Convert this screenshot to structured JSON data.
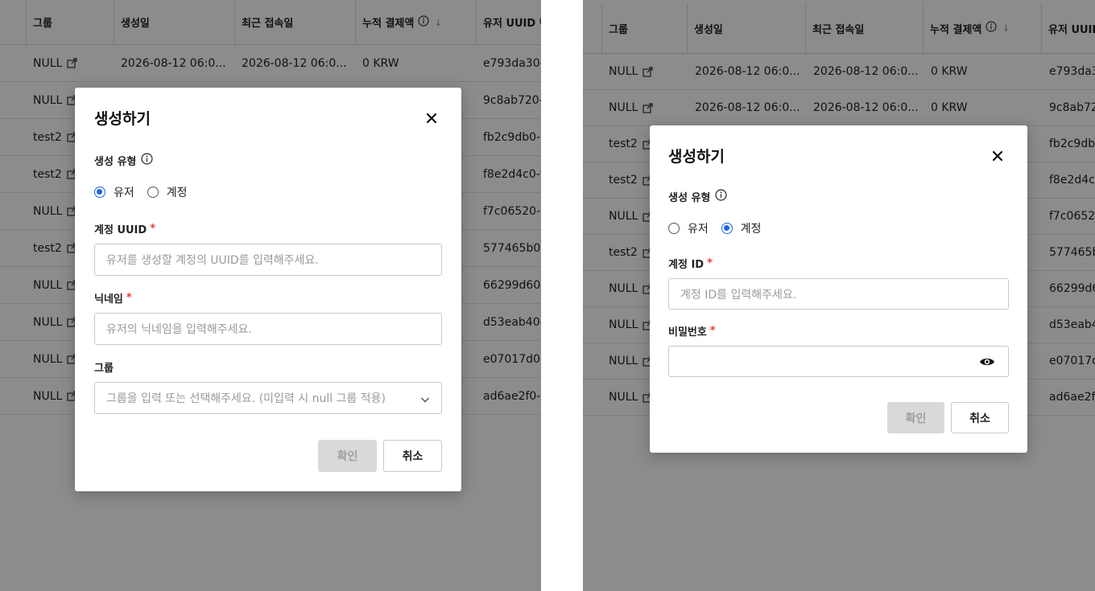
{
  "table": {
    "columns": {
      "group": "그룹",
      "created": "생성일",
      "last_access": "최근 접속일",
      "payment": "누적 결제액",
      "uuid": "유저 UUID"
    },
    "rows": [
      {
        "group": "NULL",
        "created": "2026-08-12 06:0...",
        "last_access": "2026-08-12 06:0...",
        "payment": "0 KRW",
        "uuid": "e793da30-"
      },
      {
        "group": "NULL",
        "created": "2026-08-12 06:0...",
        "last_access": "2026-08-12 06:0...",
        "payment": "0 KRW",
        "uuid": "9c8ab720-"
      },
      {
        "group": "test2",
        "created": "",
        "last_access": "",
        "payment": "",
        "uuid": "fb2c9db0-9"
      },
      {
        "group": "test2",
        "created": "",
        "last_access": "",
        "payment": "",
        "uuid": "f8e2d4c0-9"
      },
      {
        "group": "NULL",
        "created": "",
        "last_access": "",
        "payment": "",
        "uuid": "f7c06520-9"
      },
      {
        "group": "test2",
        "created": "",
        "last_access": "",
        "payment": "",
        "uuid": "577465b0-"
      },
      {
        "group": "NULL",
        "created": "",
        "last_access": "",
        "payment": "",
        "uuid": "66299d60-"
      },
      {
        "group": "NULL",
        "created": "",
        "last_access": "",
        "payment": "",
        "uuid": "d53eab40-"
      },
      {
        "group": "NULL",
        "created": "",
        "last_access": "",
        "payment": "",
        "uuid": "e07017d0-9"
      },
      {
        "group": "NULL",
        "created": "",
        "last_access": "",
        "payment": "",
        "uuid": "ad6ae2f0-9"
      }
    ]
  },
  "modal_user": {
    "title": "생성하기",
    "type_label": "생성 유형",
    "options": [
      "유저",
      "계정"
    ],
    "selected": 0,
    "uuid_label": "계정 UUID",
    "uuid_placeholder": "유저를 생성할 계정의 UUID를 입력해주세요.",
    "nickname_label": "닉네임",
    "nickname_placeholder": "유저의 닉네임을 입력해주세요.",
    "group_label": "그룹",
    "group_placeholder": "그룹을 입력 또는 선택해주세요. (미입력 시 null 그룹 적용)",
    "confirm": "확인",
    "cancel": "취소"
  },
  "modal_account": {
    "title": "생성하기",
    "type_label": "생성 유형",
    "options": [
      "유저",
      "계정"
    ],
    "selected": 1,
    "id_label": "계정 ID",
    "id_placeholder": "계정 ID를 입력해주세요.",
    "password_label": "비밀번호",
    "password_value": "",
    "confirm": "확인",
    "cancel": "취소"
  },
  "colors": {
    "accent": "#1e63e6",
    "required": "#e53935",
    "overlay": "rgba(0,0,0,0.45)"
  },
  "icons": {
    "info": "info-icon",
    "sort": "arrow-down-icon",
    "external": "external-link-icon",
    "close": "close-icon",
    "chevron": "chevron-down-icon",
    "eye": "eye-icon"
  }
}
